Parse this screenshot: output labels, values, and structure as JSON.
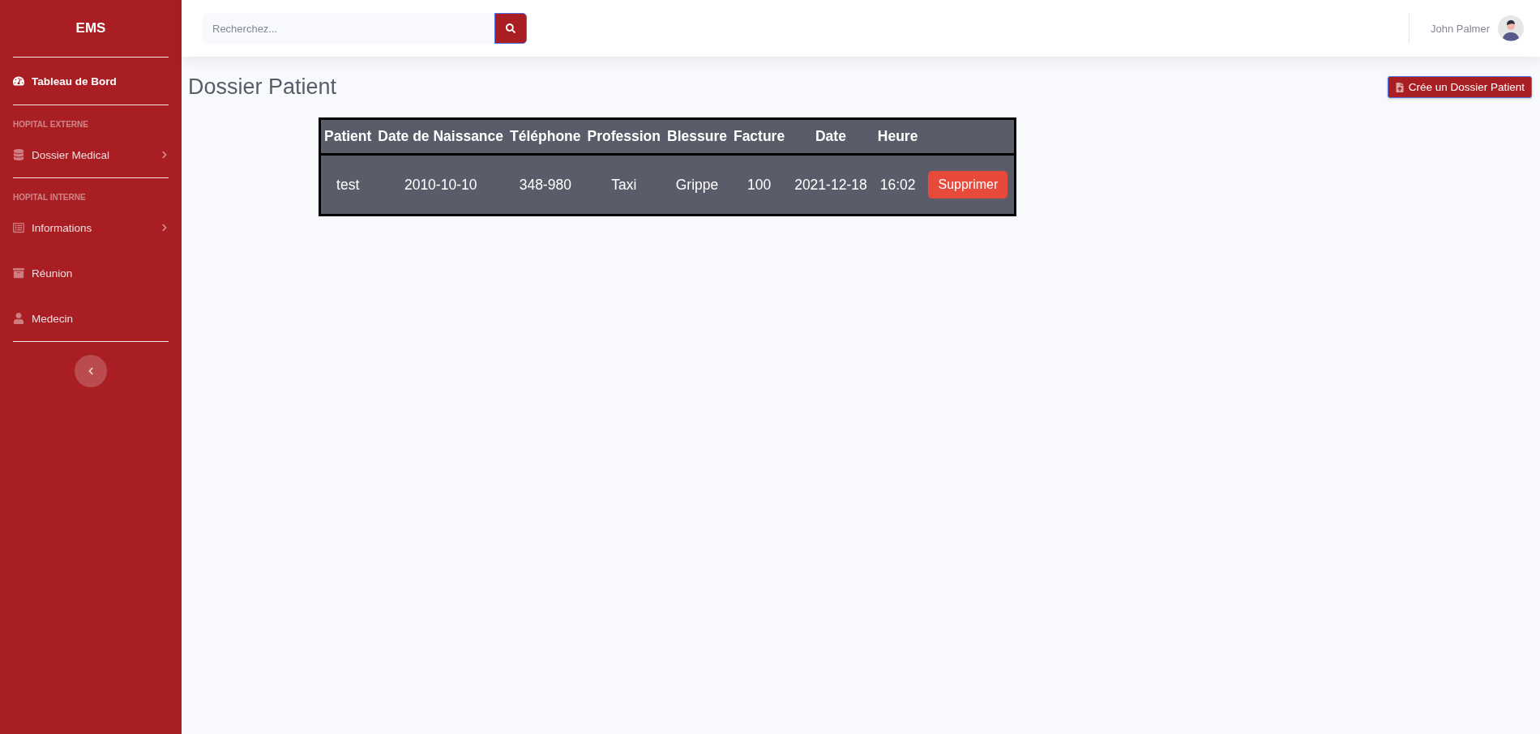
{
  "sidebar": {
    "brand": "EMS",
    "sections": [
      {
        "items": [
          {
            "label": "Tableau de Bord",
            "selected": true,
            "has_submenu": false
          }
        ]
      },
      {
        "heading": "HOPITAL EXTERNE",
        "items": [
          {
            "label": "Dossier Medical",
            "selected": false,
            "has_submenu": true
          }
        ]
      },
      {
        "heading": "HOPITAL INTERNE",
        "items": [
          {
            "label": "Informations",
            "selected": false,
            "has_submenu": true
          },
          {
            "label": "Réunion",
            "selected": false,
            "has_submenu": false
          },
          {
            "label": "Medecin",
            "selected": false,
            "has_submenu": false
          }
        ]
      }
    ]
  },
  "topbar": {
    "search": {
      "placeholder": "Recherchez..."
    },
    "user": {
      "name": "John Palmer"
    }
  },
  "page": {
    "title": "Dossier Patient",
    "create_button": "Crée un Dossier Patient"
  },
  "table": {
    "columns": [
      "Patient",
      "Date de Naissance",
      "Téléphone",
      "Profession",
      "Blessure",
      "Facture",
      "Date",
      "Heure"
    ],
    "rows": [
      {
        "cells": [
          "test",
          "2010-10-10",
          "348-980",
          "Taxi",
          "Grippe",
          "100",
          "2021-12-18",
          "16:02"
        ],
        "action": "Supprimer"
      }
    ]
  }
}
